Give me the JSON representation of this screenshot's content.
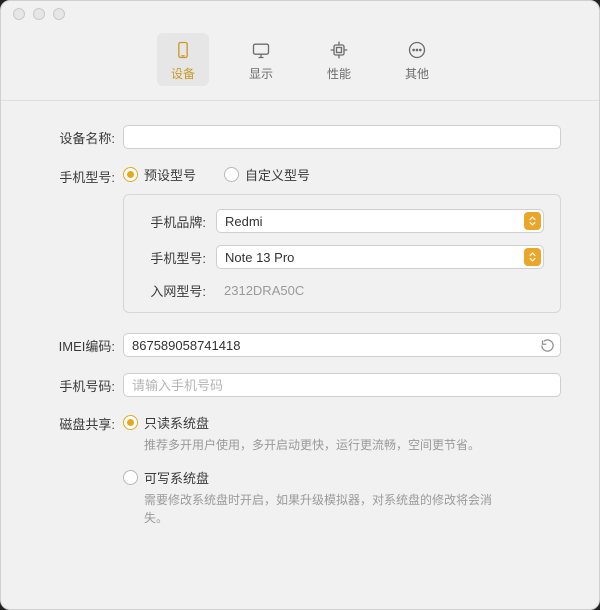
{
  "tabs": {
    "device": "设备",
    "display": "显示",
    "performance": "性能",
    "other": "其他"
  },
  "labels": {
    "device_name": "设备名称:",
    "phone_model": "手机型号:",
    "imei": "IMEI编码:",
    "phone_number": "手机号码:",
    "disk_share": "磁盘共享:"
  },
  "model_type": {
    "preset": "预设型号",
    "custom": "自定义型号"
  },
  "preset": {
    "brand_label": "手机品牌:",
    "model_label": "手机型号:",
    "net_label": "入网型号:",
    "brand_value": "Redmi",
    "model_value": "Note 13 Pro",
    "net_value": "2312DRA50C"
  },
  "device_name_value": "",
  "imei_value": "867589058741418",
  "phone_number_value": "",
  "phone_number_placeholder": "请输入手机号码",
  "disk": {
    "readonly_title": "只读系统盘",
    "readonly_desc": "推荐多开用户使用，多开启动更快，运行更流畅，空间更节省。",
    "writable_title": "可写系统盘",
    "writable_desc": "需要修改系统盘时开启，如果升级模拟器，对系统盘的修改将会消失。"
  }
}
